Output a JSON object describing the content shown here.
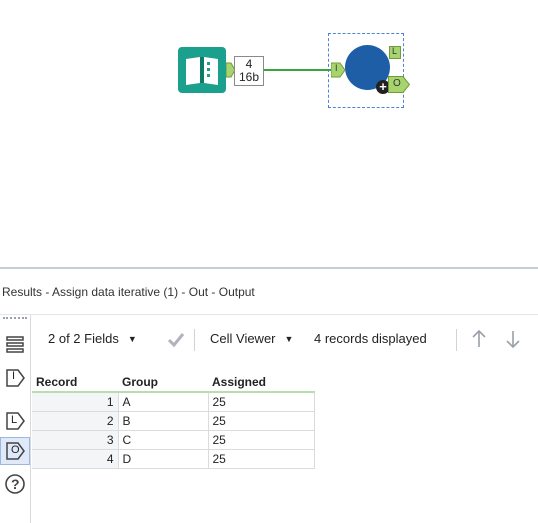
{
  "canvas": {
    "count_box": {
      "records": "4",
      "size": "16b"
    },
    "macro": {
      "input_anchor": "I",
      "output_anchor_l": "L",
      "output_anchor_o": "O"
    },
    "colors": {
      "book_tool": "#1aa08c",
      "macro_circle": "#1d5ea6",
      "anchor_green": "#a8d46f",
      "connector": "#3aa63a"
    }
  },
  "results": {
    "title": "Results - Assign data iterative (1) - Out - Output",
    "rail": {
      "icons": [
        "list-icon",
        "input-anchor-icon",
        "l-anchor-icon",
        "o-anchor-icon",
        "help-icon"
      ],
      "input_label": "I",
      "l_label": "L",
      "o_label": "O",
      "help_label": "?"
    },
    "toolbar": {
      "fields_label": "2 of 2 Fields",
      "cell_viewer_label": "Cell Viewer",
      "records_label": "4 records displayed"
    },
    "table": {
      "headers": [
        "Record",
        "Group",
        "Assigned"
      ],
      "rows": [
        {
          "record": "1",
          "group": "A",
          "assigned": "25"
        },
        {
          "record": "2",
          "group": "B",
          "assigned": "25"
        },
        {
          "record": "3",
          "group": "C",
          "assigned": "25"
        },
        {
          "record": "4",
          "group": "D",
          "assigned": "25"
        }
      ]
    }
  }
}
